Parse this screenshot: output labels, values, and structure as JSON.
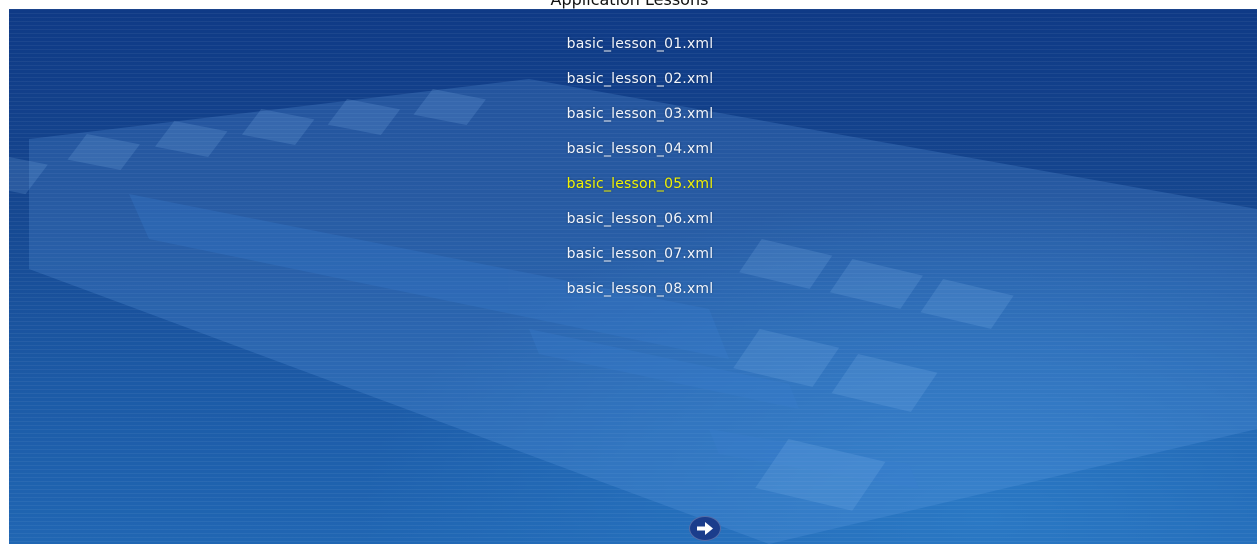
{
  "window": {
    "title": "Application Lessons"
  },
  "lessons": {
    "items": [
      "basic_lesson_01.xml",
      "basic_lesson_02.xml",
      "basic_lesson_03.xml",
      "basic_lesson_04.xml",
      "basic_lesson_05.xml",
      "basic_lesson_06.xml",
      "basic_lesson_07.xml",
      "basic_lesson_08.xml"
    ],
    "selected": "basic_lesson_05.xml"
  },
  "colors": {
    "item_text": "#f2f5fb",
    "selected_text": "#f2f200",
    "background": "#15468f"
  },
  "icons": {
    "next": "arrow-right-icon"
  }
}
